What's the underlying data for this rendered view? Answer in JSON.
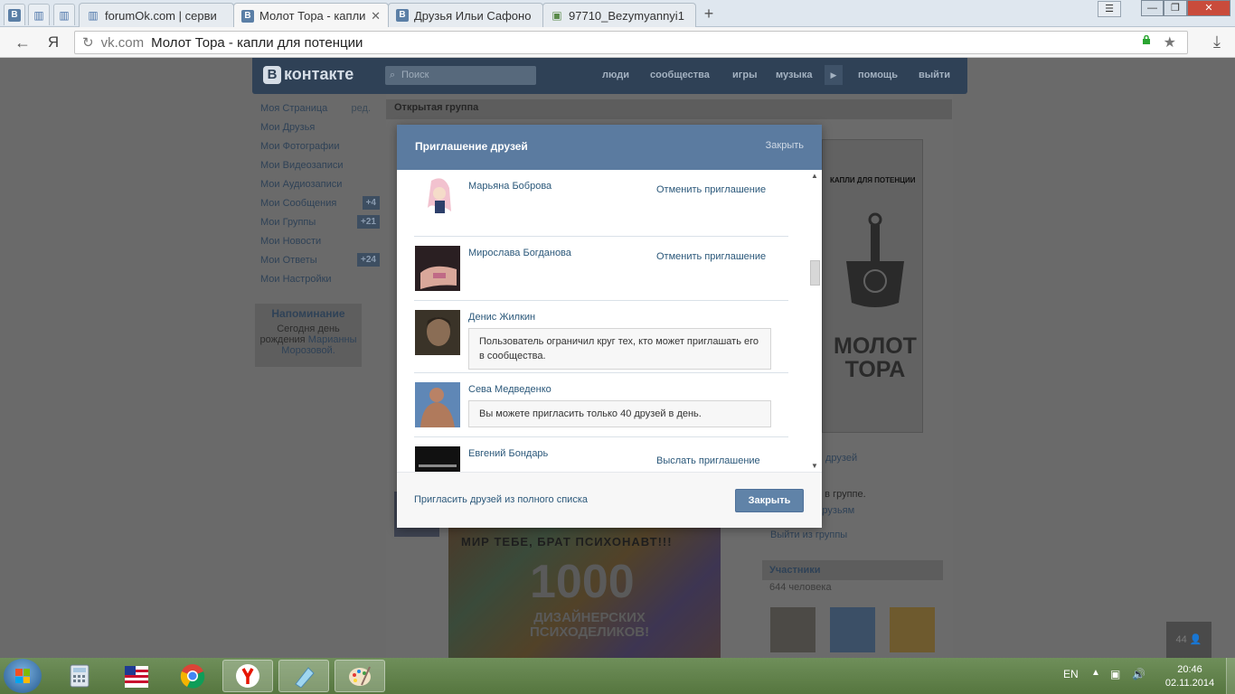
{
  "browser": {
    "tabs": [
      {
        "label": "forumOk.com | серви"
      },
      {
        "label": "Молот Тора - капли д"
      },
      {
        "label": "Друзья Ильи Сафоно"
      },
      {
        "label": "97710_Bezymyannyi1"
      }
    ],
    "address": {
      "back": "←",
      "yandex": "Я",
      "host": "vk.com",
      "page_title": "Молот Тора - капли для потенции"
    }
  },
  "vk": {
    "logo": "контакте",
    "search_placeholder": "Поиск",
    "topnav": [
      "люди",
      "сообщества",
      "игры",
      "музыка",
      "помощь",
      "выйти"
    ],
    "menu": [
      {
        "label": "Моя Страница",
        "extra": "ред."
      },
      {
        "label": "Мои Друзья"
      },
      {
        "label": "Мои Фотографии"
      },
      {
        "label": "Мои Видеозаписи"
      },
      {
        "label": "Мои Аудиозаписи"
      },
      {
        "label": "Мои Сообщения",
        "count": "+4"
      },
      {
        "label": "Мои Группы",
        "count": "+21"
      },
      {
        "label": "Мои Новости"
      },
      {
        "label": "Мои Ответы",
        "count": "+24"
      },
      {
        "label": "Мои Настройки"
      }
    ],
    "reminder": {
      "title": "Напоминание",
      "text1": "Сегодня",
      "text2": "день",
      "text3": "рождения",
      "name1": "Марианны",
      "name2": "Морозовой."
    },
    "group_header": "Открытая группа",
    "product": {
      "top_text": "КАПЛИ ДЛЯ ПОТЕНЦИИ",
      "big_text": "МОЛОТ ТОРА"
    },
    "invite_friends_tail": "друзей",
    "member_text": "е в группе.",
    "friends_tail": "друзьям",
    "leave_group": "Выйти из группы",
    "members_title": "Участники",
    "members_count": "644 человека",
    "psy": {
      "line1": "МИР ТЕБЕ, БРАТ ПСИХОНАВТ!!!",
      "line2": "1000",
      "line3": "ДИЗАЙНЕРСКИХ",
      "line4": "ПСИХОДЕЛИКОВ!"
    },
    "float_count": "44"
  },
  "modal": {
    "title": "Приглашение друзей",
    "close_link": "Закрыть",
    "friends": [
      {
        "name": "Марьяна Боброва",
        "action": "Отменить приглашение"
      },
      {
        "name": "Мирослава Богданова",
        "action": "Отменить приглашение"
      },
      {
        "name": "Денис Жилкин",
        "notice": "Пользователь ограничил круг тех, кто может приглашать его в сообщества."
      },
      {
        "name": "Сева Медведенко",
        "notice": "Вы можете пригласить только 40 друзей в день."
      },
      {
        "name": "Евгений Бондарь",
        "action": "Выслать приглашение"
      }
    ],
    "footer_link": "Пригласить друзей из полного списка",
    "footer_button": "Закрыть"
  },
  "taskbar": {
    "lang": "EN",
    "time": "20:46",
    "date": "02.11.2014"
  },
  "colors": {
    "vk_blue": "#5b7ba0",
    "link": "#2b587a",
    "button": "#6083a8"
  }
}
